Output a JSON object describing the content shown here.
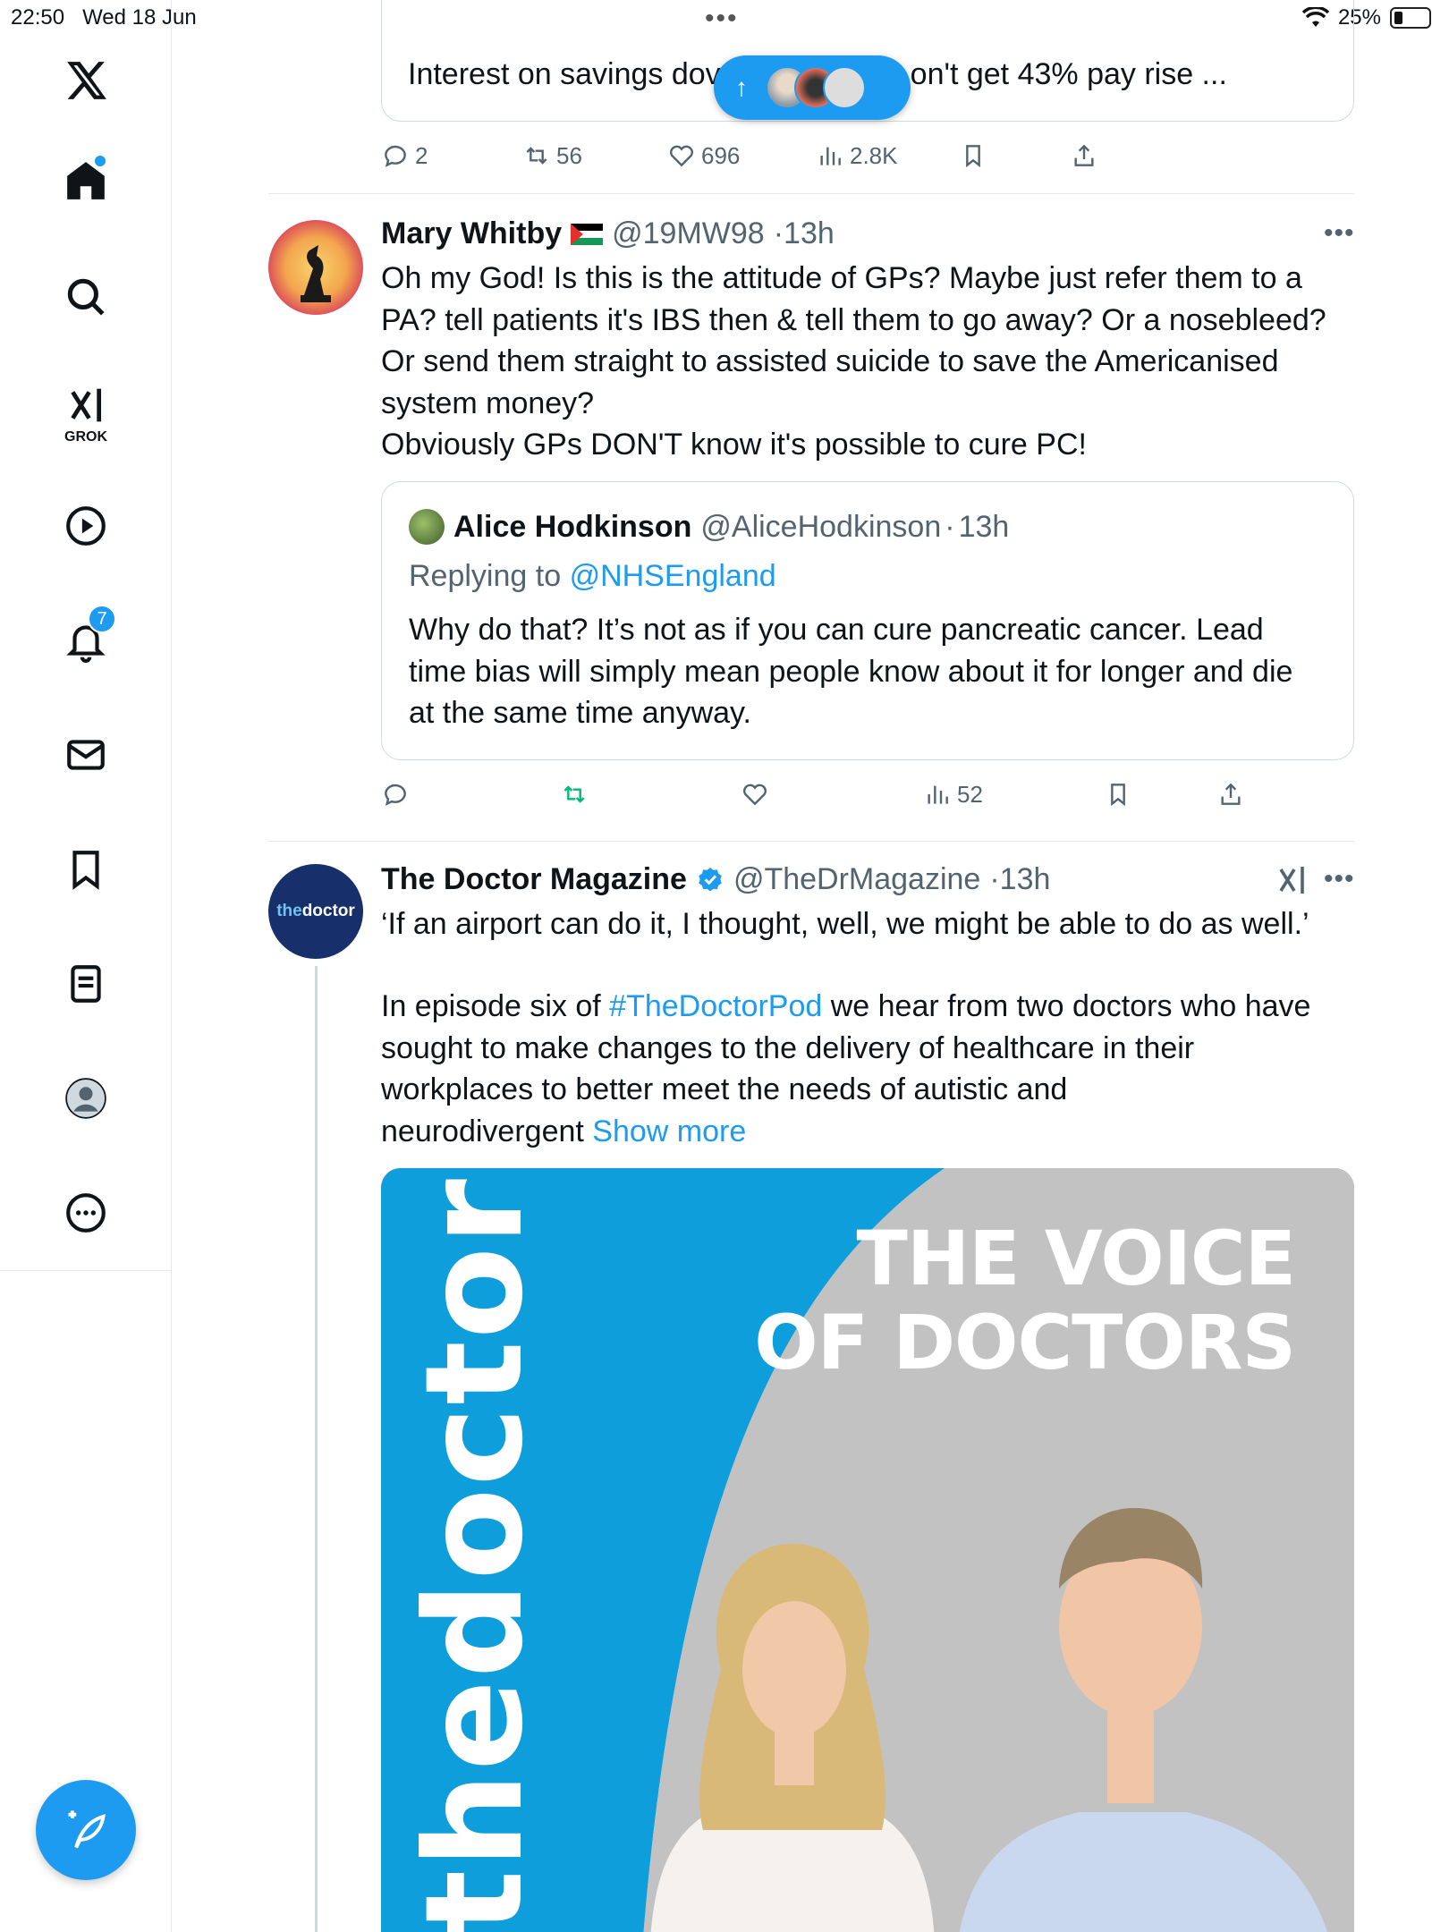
{
  "status_bar": {
    "time": "22:50",
    "date": "Wed 18 Jun",
    "battery": "25%"
  },
  "sidebar": {
    "notifications_badge": "7",
    "grok_label": "GROK"
  },
  "prev_post": {
    "quote_text_left": "Interest on savings dov",
    "quote_text_right": "on't get 43% pay rise ...",
    "replies": "2",
    "reposts": "56",
    "likes": "696",
    "views": "2.8K"
  },
  "post1": {
    "name": "Mary Whitby",
    "handle": "@19MW98",
    "time": "13h",
    "text": "Oh my God! Is this is the attitude of GPs? Maybe just refer them to a\nPA? tell patients it's IBS then & tell them to go away? Or a nosebleed?\nOr send them straight to assisted suicide to save the Americanised\nsystem money?\nObviously GPs DON'T know it's possible to cure PC!",
    "quote": {
      "name": "Alice Hodkinson",
      "handle": "@AliceHodkinson",
      "time": "13h",
      "replying_prefix": "Replying to",
      "replying_handle": "@NHSEngland",
      "text": "Why do that? It’s not as if you can cure pancreatic cancer. Lead time bias will simply mean people know about it for longer and die at the same time anyway."
    },
    "views": "52"
  },
  "post2": {
    "avatar_text_a": "the",
    "avatar_text_b": "doctor",
    "name": "The Doctor Magazine",
    "handle": "@TheDrMagazine",
    "time": "13h",
    "line1": "‘If an airport can do it, I thought, well, we might be able to do as well.’",
    "para_prefix": "In episode six of ",
    "hashtag": "#TheDoctorPod",
    "para_rest": " we hear from two doctors who have\nsought to make changes to the delivery of healthcare in their\nworkplaces to better meet the needs of autistic and\nneurodivergent ",
    "show_more": "Show more",
    "media": {
      "vertical_brand": "thedoctor",
      "headline_1": "THE VOICE",
      "headline_2": "OF DOCTORS"
    }
  },
  "colors": {
    "accent": "#1d9bf0",
    "repost_active": "#00ba7c",
    "muted": "#536471"
  }
}
